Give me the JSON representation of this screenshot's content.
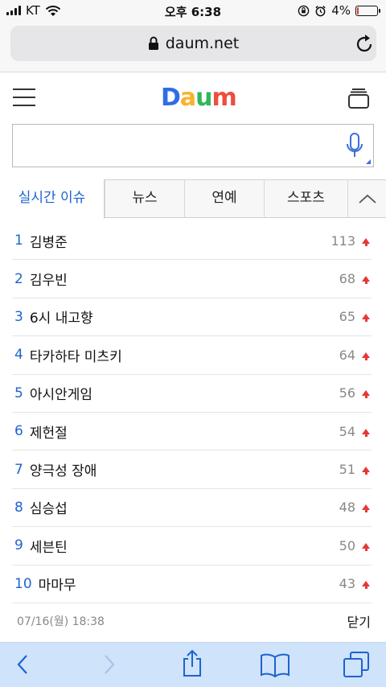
{
  "status_bar": {
    "carrier": "KT",
    "time": "오후 6:38",
    "battery_percent_text": "4%",
    "battery_level": 0.04,
    "icons": [
      "signal-icon",
      "wifi-icon",
      "rotation-lock-icon",
      "alarm-icon",
      "battery-icon"
    ]
  },
  "browser": {
    "url": "daum.net",
    "icons": [
      "lock-icon",
      "reload-icon"
    ]
  },
  "header": {
    "logo": "Daum",
    "icons": [
      "hamburger-menu-icon",
      "tabs-icon",
      "microphone-icon"
    ]
  },
  "search": {
    "value": "",
    "placeholder": ""
  },
  "tabs": [
    {
      "label": "실시간 이슈",
      "active": true
    },
    {
      "label": "뉴스",
      "active": false
    },
    {
      "label": "연예",
      "active": false
    },
    {
      "label": "스포츠",
      "active": false
    }
  ],
  "issues": [
    {
      "rank": "1",
      "keyword": "김병준",
      "count": "113",
      "trend": "up"
    },
    {
      "rank": "2",
      "keyword": "김우빈",
      "count": "68",
      "trend": "up"
    },
    {
      "rank": "3",
      "keyword": "6시 내고향",
      "count": "65",
      "trend": "up"
    },
    {
      "rank": "4",
      "keyword": "타카하타 미츠키",
      "count": "64",
      "trend": "up"
    },
    {
      "rank": "5",
      "keyword": "아시안게임",
      "count": "56",
      "trend": "up"
    },
    {
      "rank": "6",
      "keyword": "제헌절",
      "count": "54",
      "trend": "up"
    },
    {
      "rank": "7",
      "keyword": "양극성 장애",
      "count": "51",
      "trend": "up"
    },
    {
      "rank": "8",
      "keyword": "심승섭",
      "count": "48",
      "trend": "up"
    },
    {
      "rank": "9",
      "keyword": "세븐틴",
      "count": "50",
      "trend": "up"
    },
    {
      "rank": "10",
      "keyword": "마마무",
      "count": "43",
      "trend": "up"
    }
  ],
  "footer": {
    "timestamp": "07/16(월) 18:38",
    "close_label": "닫기"
  },
  "toolbar": {
    "icons": [
      "back-icon",
      "forward-icon",
      "share-icon",
      "bookmarks-icon",
      "tabs-overview-icon"
    ]
  },
  "colors": {
    "accent_blue": "#1e63d0",
    "trend_up_red": "#e53935",
    "toolbar_bg": "#cfe3fb"
  }
}
